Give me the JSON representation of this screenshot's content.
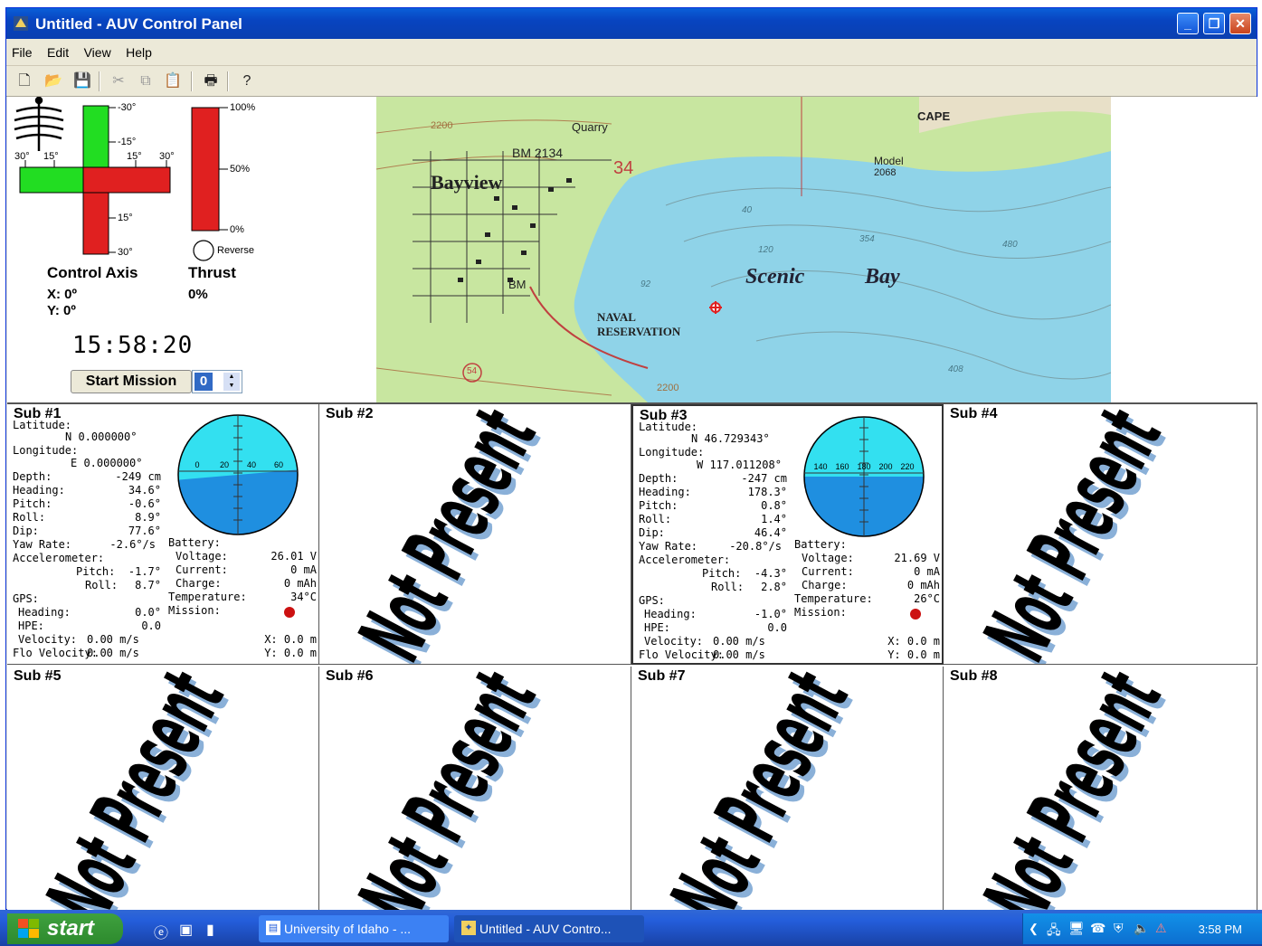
{
  "window": {
    "title": "Untitled - AUV Control Panel",
    "menu": [
      "File",
      "Edit",
      "View",
      "Help"
    ],
    "toolbar_icons": [
      "new-icon",
      "open-icon",
      "save-icon",
      "cut-icon",
      "copy-icon",
      "paste-icon",
      "print-icon",
      "help-icon"
    ]
  },
  "control": {
    "axis_title": "Control Axis",
    "x_readout": "X: 0º",
    "y_readout": "Y: 0º",
    "axis_ticks": {
      "top": "-30°",
      "upper": "-15°",
      "left_outer": "30°",
      "left_inner": "15°",
      "right_inner": "15°",
      "right_outer": "30°",
      "lower": "15°",
      "bottom": "30°"
    },
    "thrust_title": "Thrust",
    "thrust_value": "0%",
    "thrust_ticks": {
      "top": "100%",
      "mid": "50%",
      "bottom": "0%"
    },
    "reverse_label": "Reverse",
    "clock": "15:58:20",
    "start_button": "Start Mission",
    "mission_number": "0"
  },
  "map": {
    "labels": {
      "bayview": "Bayview",
      "bm": "BM 2134",
      "quarry": "Quarry",
      "section": "34",
      "scenic": "Scenic",
      "bay": "Bay",
      "naval1": "NAVAL",
      "naval2": "RESERVATION",
      "cape": "CAPE",
      "model": "Model",
      "model_num": "2068",
      "bm2": "BM",
      "hwy": "54",
      "contour_top": "2200",
      "contour_bottom": "2200",
      "d1": "40",
      "d2": "120",
      "d3": "354",
      "d4": "480",
      "d5": "92",
      "d6": "408"
    }
  },
  "subs": [
    {
      "name": "Sub #1",
      "present": true,
      "latitude": "N 0.000000°",
      "longitude": "E 0.000000°",
      "depth": "-249 cm",
      "heading": "34.6°",
      "pitch": "-0.6°",
      "roll": "8.9°",
      "dip": "77.6°",
      "yaw_rate": "-2.6°/s",
      "acc_pitch": "-1.7°",
      "acc_roll": "8.7°",
      "gps_heading": "0.0°",
      "hpe": "0.0",
      "velocity": "0.00 m/s",
      "flo_velocity": "0.00 m/s",
      "voltage": "26.01 V",
      "current": "0 mA",
      "charge": "0 mAh",
      "temperature": "34°C",
      "x": "X: 0.0 m",
      "y": "Y: 0.0 m",
      "compass_ticks": [
        "0",
        "20",
        "40",
        "60"
      ]
    },
    {
      "name": "Sub #2",
      "present": false
    },
    {
      "name": "Sub #3",
      "present": true,
      "latitude": "N 46.729343°",
      "longitude": "W 117.011208°",
      "depth": "-247 cm",
      "heading": "178.3°",
      "pitch": "0.8°",
      "roll": "1.4°",
      "dip": "46.4°",
      "yaw_rate": "-20.8°/s",
      "acc_pitch": "-4.3°",
      "acc_roll": "2.8°",
      "gps_heading": "-1.0°",
      "hpe": "0.0",
      "velocity": "0.00 m/s",
      "flo_velocity": "0.00 m/s",
      "voltage": "21.69 V",
      "current": "0 mA",
      "charge": "0 mAh",
      "temperature": "26°C",
      "x": "X: 0.0 m",
      "y": "Y: 0.0 m",
      "compass_ticks": [
        "140",
        "160",
        "180",
        "200",
        "220"
      ]
    },
    {
      "name": "Sub #4",
      "present": false
    },
    {
      "name": "Sub #5",
      "present": false
    },
    {
      "name": "Sub #6",
      "present": false
    },
    {
      "name": "Sub #7",
      "present": false
    },
    {
      "name": "Sub #8",
      "present": false
    }
  ],
  "labels": {
    "latitude": "Latitude:",
    "longitude": "Longitude:",
    "depth": "Depth:",
    "heading": "Heading:",
    "pitch": "Pitch:",
    "roll": "Roll:",
    "dip": "Dip:",
    "yaw_rate": "Yaw Rate:",
    "accelerometer": "Accelerometer:",
    "acc_pitch": "Pitch:",
    "acc_roll": "Roll:",
    "gps": "GPS:",
    "gps_heading": "Heading:",
    "hpe": "HPE:",
    "velocity": "Velocity:",
    "flo_velocity": "Flo Velocity:",
    "battery": "Battery:",
    "voltage": "Voltage:",
    "current": "Current:",
    "charge": "Charge:",
    "temperature": "Temperature:",
    "mission": "Mission:",
    "not_present": "Not Present"
  },
  "taskbar": {
    "start": "start",
    "tasks": [
      "University of Idaho - ...",
      "Untitled - AUV Contro..."
    ],
    "clock": "3:58 PM"
  },
  "colors": {
    "axis_green": "#22dd22",
    "axis_red": "#e02020",
    "water": "#8fd3e8",
    "land": "#c8e6a0",
    "compass_sky": "#33e0f0",
    "compass_sea": "#1f8fe0",
    "mission_led": "#cc1111"
  }
}
